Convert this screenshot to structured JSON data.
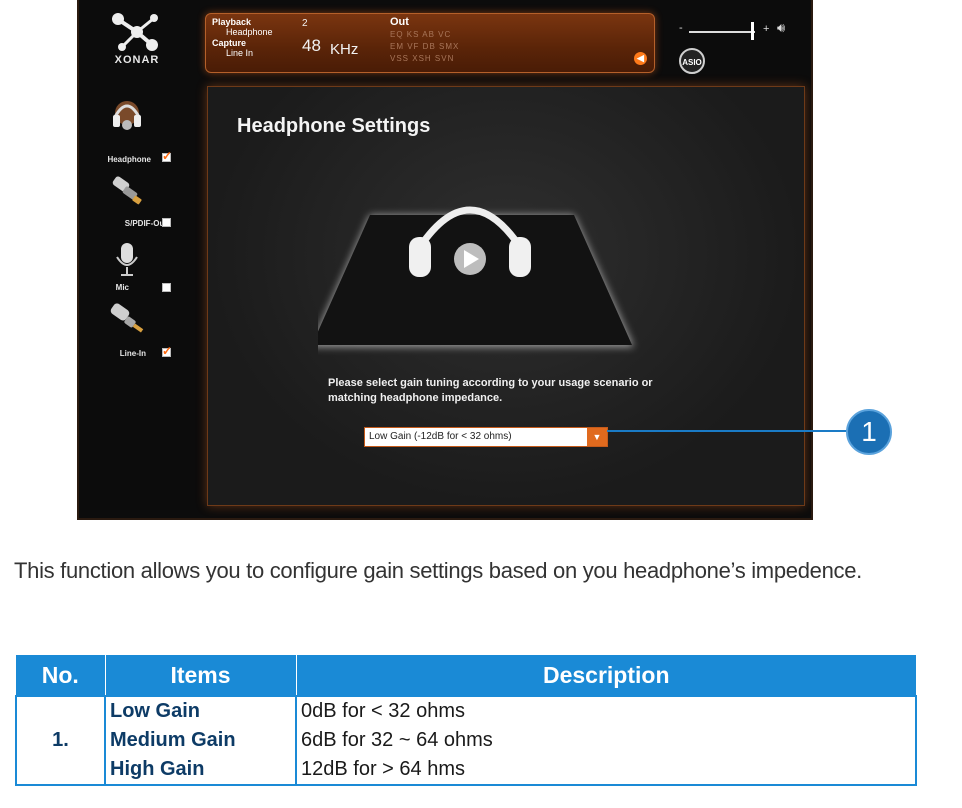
{
  "app": {
    "logo_text": "XONAR",
    "status": {
      "playback_label": "Playback",
      "playback_device": "Headphone",
      "capture_label": "Capture",
      "capture_device": "Line In",
      "channels": "2",
      "sample_rate": "48",
      "sample_unit": "KHz",
      "out_label": "Out",
      "effects_row1": "EQ  KS  AB  VC",
      "effects_row2": "EM  VF  DB  SMX",
      "effects_row3": "VSS XSH SVN"
    },
    "volume": {
      "minus": "-",
      "plus": "+",
      "level": 0.9
    },
    "asio_label": "ASIO",
    "sidebar": [
      {
        "label": "Headphone",
        "checked": true,
        "icon": "headphone-icon"
      },
      {
        "label": "S/PDIF-Out",
        "checked": false,
        "icon": "spdif-icon"
      },
      {
        "label": "Mic",
        "checked": false,
        "icon": "microphone-icon"
      },
      {
        "label": "Line-In",
        "checked": true,
        "icon": "line-in-icon"
      }
    ],
    "content": {
      "title": "Headphone Settings",
      "instructions": "Please select gain tuning according to your usage scenario or matching headphone impedance.",
      "gain_select_value": "Low Gain (-12dB for < 32 ohms)"
    }
  },
  "callout_number": "1",
  "description": "This function allows you to configure gain settings based on you headphone’s impedence.",
  "table": {
    "headers": [
      "No.",
      "Items",
      "Description"
    ],
    "row": {
      "no": "1.",
      "items": [
        "Low Gain",
        "Medium Gain",
        "High Gain"
      ],
      "descriptions": [
        "0dB for < 32 ohms",
        "6dB for 32 ~ 64 ohms",
        "12dB for > 64 hms"
      ]
    }
  },
  "colors": {
    "accent_orange": "#e06a1e",
    "table_blue": "#1a8ad6",
    "callout_blue": "#1b6fb4"
  }
}
